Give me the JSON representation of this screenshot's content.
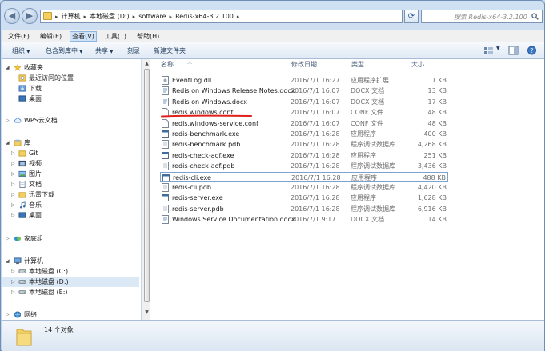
{
  "address": {
    "crumbs": [
      "计算机",
      "本地磁盘 (D:)",
      "software",
      "Redis-x64-3.2.100"
    ],
    "search_placeholder": "搜索 Redis-x64-3.2.100"
  },
  "menu": [
    "文件(F)",
    "编辑(E)",
    "查看(V)",
    "工具(T)",
    "帮助(H)"
  ],
  "toolbar": {
    "organize": "组织",
    "include_library": "包含到库中",
    "share": "共享",
    "burn": "刻录",
    "new_folder": "新建文件夹"
  },
  "nav": {
    "favorites": "收藏夹",
    "recent": "最近访问的位置",
    "downloads": "下载",
    "desktop": "桌面",
    "wps": "WPS云文档",
    "libraries": "库",
    "git": "Git",
    "videos": "视频",
    "pictures": "图片",
    "documents": "文档",
    "thunder": "迅雷下载",
    "music": "音乐",
    "lib_desktop": "桌面",
    "homegroup": "家庭组",
    "computer": "计算机",
    "drive_c": "本地磁盘 (C:)",
    "drive_d": "本地磁盘 (D:)",
    "drive_e": "本地磁盘 (E:)",
    "network": "网络"
  },
  "columns": {
    "name": "名称",
    "date": "修改日期",
    "type": "类型",
    "size": "大小"
  },
  "files": [
    {
      "name": "EventLog.dll",
      "date": "2016/7/1 16:27",
      "type": "应用程序扩展",
      "size": "1 KB",
      "icon": "dll"
    },
    {
      "name": "Redis on Windows Release Notes.docx",
      "date": "2016/7/1 16:07",
      "type": "DOCX 文档",
      "size": "13 KB",
      "icon": "doc"
    },
    {
      "name": "Redis on Windows.docx",
      "date": "2016/7/1 16:07",
      "type": "DOCX 文档",
      "size": "17 KB",
      "icon": "doc"
    },
    {
      "name": "redis.windows.conf",
      "date": "2016/7/1 16:07",
      "type": "CONF 文件",
      "size": "48 KB",
      "icon": "file"
    },
    {
      "name": "redis.windows-service.conf",
      "date": "2016/7/1 16:07",
      "type": "CONF 文件",
      "size": "48 KB",
      "icon": "file"
    },
    {
      "name": "redis-benchmark.exe",
      "date": "2016/7/1 16:28",
      "type": "应用程序",
      "size": "400 KB",
      "icon": "exe"
    },
    {
      "name": "redis-benchmark.pdb",
      "date": "2016/7/1 16:28",
      "type": "程序调试数据库",
      "size": "4,268 KB",
      "icon": "pdb"
    },
    {
      "name": "redis-check-aof.exe",
      "date": "2016/7/1 16:28",
      "type": "应用程序",
      "size": "251 KB",
      "icon": "exe"
    },
    {
      "name": "redis-check-aof.pdb",
      "date": "2016/7/1 16:28",
      "type": "程序调试数据库",
      "size": "3,436 KB",
      "icon": "pdb"
    },
    {
      "name": "redis-cli.exe",
      "date": "2016/7/1 16:28",
      "type": "应用程序",
      "size": "488 KB",
      "icon": "exe"
    },
    {
      "name": "redis-cli.pdb",
      "date": "2016/7/1 16:28",
      "type": "程序调试数据库",
      "size": "4,420 KB",
      "icon": "pdb"
    },
    {
      "name": "redis-server.exe",
      "date": "2016/7/1 16:28",
      "type": "应用程序",
      "size": "1,628 KB",
      "icon": "exe"
    },
    {
      "name": "redis-server.pdb",
      "date": "2016/7/1 16:28",
      "type": "程序调试数据库",
      "size": "6,916 KB",
      "icon": "pdb"
    },
    {
      "name": "Windows Service Documentation.docx",
      "date": "2016/7/1 9:17",
      "type": "DOCX 文档",
      "size": "14 KB",
      "icon": "doc"
    }
  ],
  "details": {
    "count": "14 个对象"
  },
  "colors": {
    "annotation": "#e0201a",
    "accent": "#3a6ea5"
  }
}
